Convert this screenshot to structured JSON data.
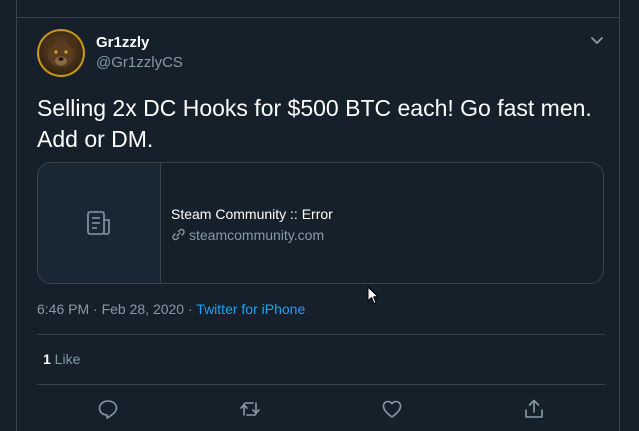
{
  "tweet": {
    "display_name": "Gr1zzly",
    "handle": "@Gr1zzlyCS",
    "text": "Selling 2x DC Hooks for $500 BTC each! Go fast men. Add or DM.",
    "card": {
      "title": "Steam Community :: Error",
      "domain": "steamcommunity.com",
      "media_icon": "document-icon",
      "link_icon": "link-icon"
    },
    "timestamp": "6:46 PM · Feb 28, 2020",
    "separator": " · ",
    "source": "Twitter for iPhone",
    "likes": {
      "count": "1",
      "label": " Like"
    }
  },
  "icons": {
    "caret": "chevron-down-icon",
    "reply": "reply-icon",
    "retweet": "retweet-icon",
    "like": "heart-icon",
    "share": "share-icon"
  },
  "colors": {
    "background": "#15202b",
    "border": "#38444d",
    "secondary_text": "#8899a6",
    "accent": "#1da1f2"
  }
}
